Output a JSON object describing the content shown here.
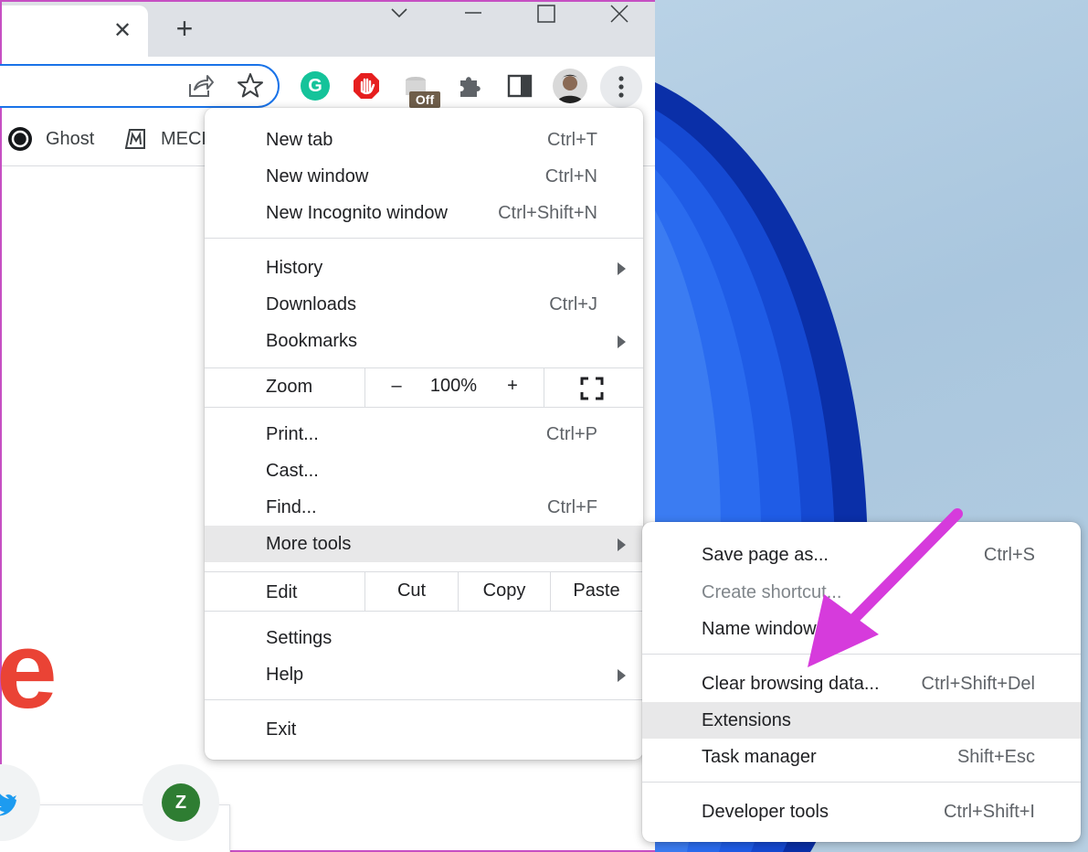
{
  "window": {
    "tab_close_glyph": "✕",
    "new_tab_glyph": "+"
  },
  "toolbar": {
    "extensions_badge": "Off",
    "grammarly_letter": "G"
  },
  "bookmarks_bar": {
    "items": [
      {
        "label": "Ghost"
      },
      {
        "label": "MECK"
      }
    ]
  },
  "page": {
    "logo_fragment": "e",
    "shortcut_letter": "Z"
  },
  "menu": {
    "items": [
      {
        "label": "New tab",
        "shortcut": "Ctrl+T"
      },
      {
        "label": "New window",
        "shortcut": "Ctrl+N"
      },
      {
        "label": "New Incognito window",
        "shortcut": "Ctrl+Shift+N"
      },
      {
        "label": "History",
        "shortcut": ""
      },
      {
        "label": "Downloads",
        "shortcut": "Ctrl+J"
      },
      {
        "label": "Bookmarks",
        "shortcut": ""
      },
      {
        "label": "Print...",
        "shortcut": "Ctrl+P"
      },
      {
        "label": "Cast...",
        "shortcut": ""
      },
      {
        "label": "Find...",
        "shortcut": "Ctrl+F"
      },
      {
        "label": "More tools",
        "shortcut": ""
      },
      {
        "label": "Settings",
        "shortcut": ""
      },
      {
        "label": "Help",
        "shortcut": ""
      },
      {
        "label": "Exit",
        "shortcut": ""
      }
    ],
    "zoom": {
      "label": "Zoom",
      "minus": "–",
      "value": "100%",
      "plus": "+"
    },
    "edit": {
      "label": "Edit",
      "cut": "Cut",
      "copy": "Copy",
      "paste": "Paste"
    }
  },
  "submenu": {
    "items": [
      {
        "label": "Save page as...",
        "shortcut": "Ctrl+S"
      },
      {
        "label": "Create shortcut...",
        "shortcut": ""
      },
      {
        "label": "Name window...",
        "shortcut": ""
      },
      {
        "label": "Clear browsing data...",
        "shortcut": "Ctrl+Shift+Del"
      },
      {
        "label": "Extensions",
        "shortcut": ""
      },
      {
        "label": "Task manager",
        "shortcut": "Shift+Esc"
      },
      {
        "label": "Developer tools",
        "shortcut": "Ctrl+Shift+I"
      }
    ]
  },
  "colors": {
    "accent_blue": "#1a73e8",
    "annotation_arrow": "#d63bdc",
    "highlight": "#e8e8e9",
    "wallpaper_blue": "#1f4fd6"
  }
}
